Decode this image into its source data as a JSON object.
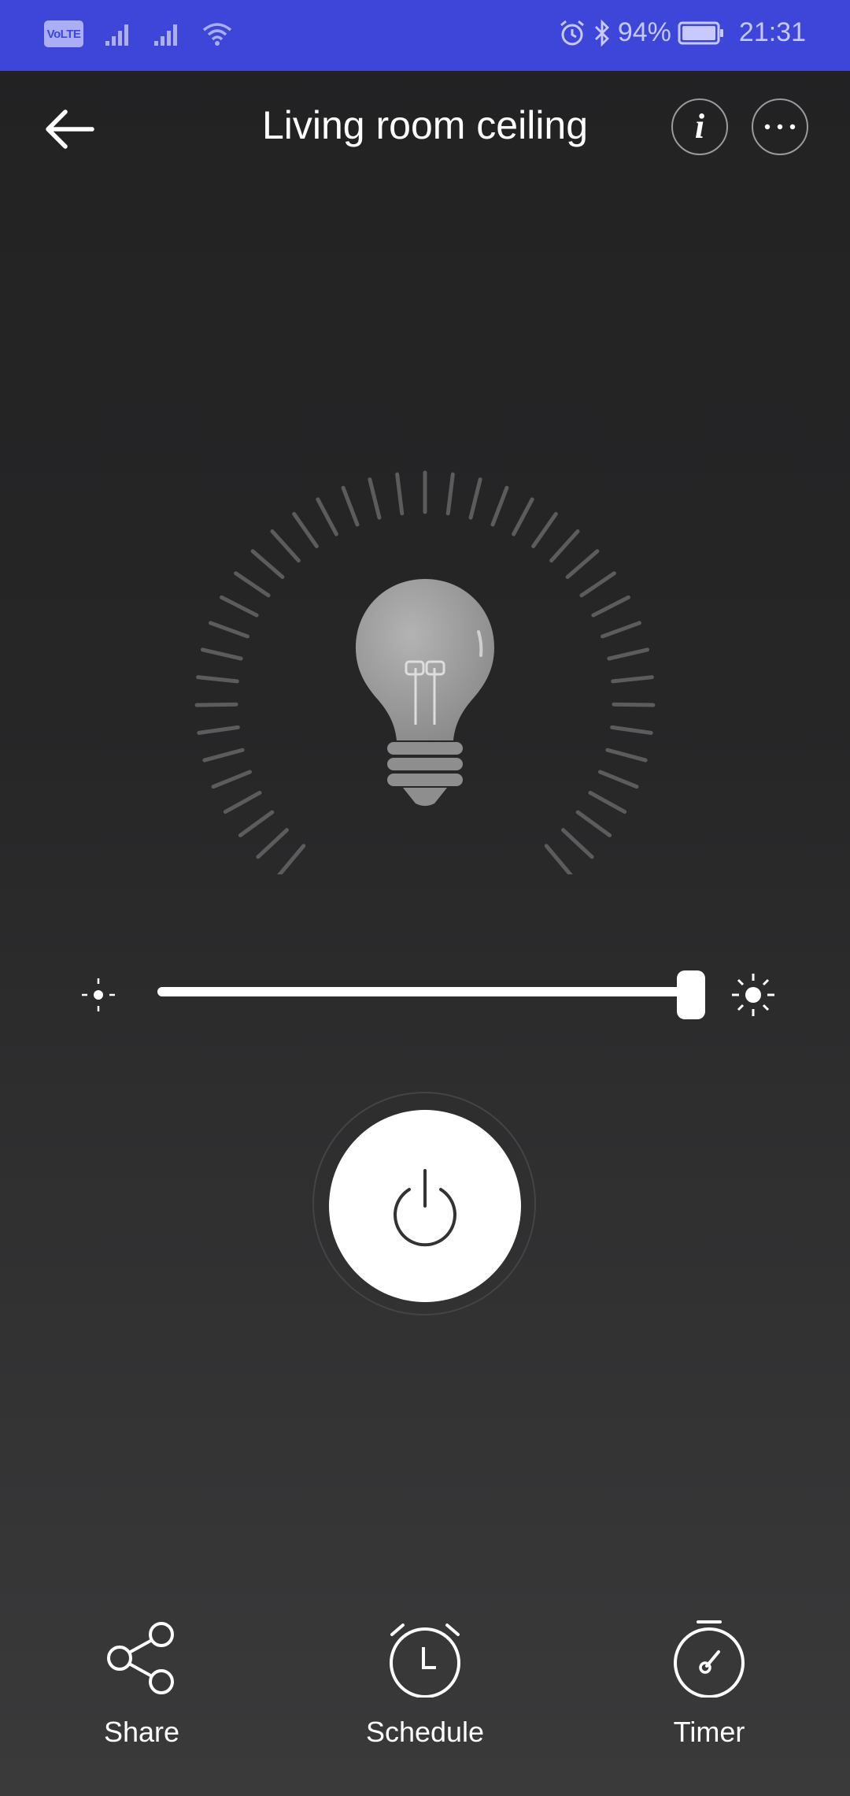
{
  "status_bar": {
    "volte": "VoLTE",
    "battery": "94%",
    "time": "21:31",
    "background_color": "#3d46d8"
  },
  "header": {
    "title": "Living room ceiling",
    "back_icon": "arrow-left-icon",
    "info_icon": "info-icon",
    "more_icon": "more-horizontal-icon"
  },
  "lamp": {
    "icon": "light-bulb-icon",
    "state": "off"
  },
  "brightness": {
    "value_fraction": 1.0,
    "min_icon": "brightness-low-icon",
    "max_icon": "brightness-high-icon"
  },
  "power": {
    "icon": "power-icon"
  },
  "actions": [
    {
      "label": "Share",
      "icon": "share-icon"
    },
    {
      "label": "Schedule",
      "icon": "alarm-clock-icon"
    },
    {
      "label": "Timer",
      "icon": "stopwatch-icon"
    }
  ],
  "colors": {
    "background": "#252526",
    "accent": "#ffffff"
  }
}
